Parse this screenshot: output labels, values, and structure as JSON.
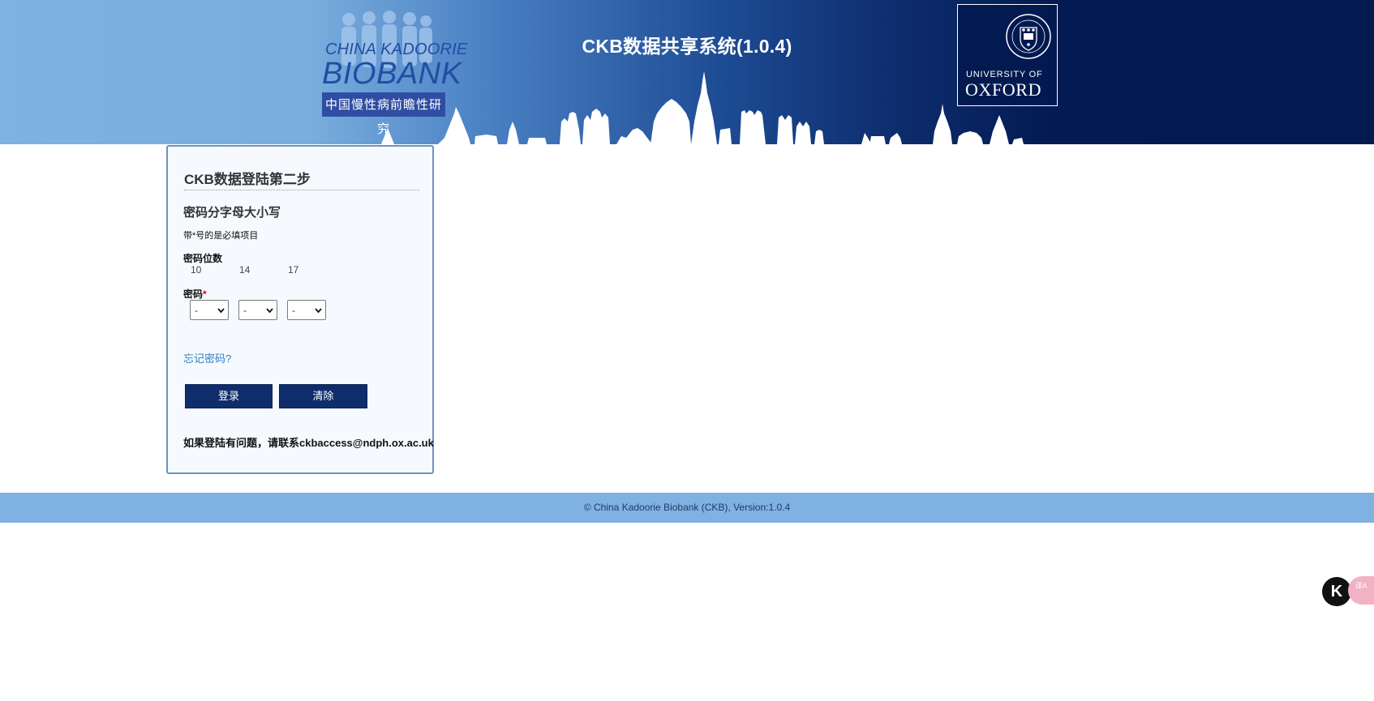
{
  "header": {
    "title": "CKB数据共享系统(1.0.4)",
    "ckb_logo": {
      "line1": "CHINA KADOORIE",
      "line2": "BIOBANK",
      "chinese": "中国慢性病前瞻性研究"
    },
    "oxford_logo": {
      "line1": "UNIVERSITY OF",
      "line2": "OXFORD"
    }
  },
  "login": {
    "title": "CKB数据登陆第二步",
    "case_note": "密码分字母大小写",
    "required_note": "带*号的是必填项目",
    "digits_label": "密码位数",
    "digits": [
      "10",
      "14",
      "17"
    ],
    "password_label": "密码",
    "required_marker": "*",
    "selects": [
      "-",
      "-",
      "-"
    ],
    "forgot": "忘记密码?",
    "login_button": "登录",
    "clear_button": "清除",
    "contact": "如果登陆有问题，请联系ckbaccess@ndph.ox.ac.uk"
  },
  "footer": {
    "text": "© China Kadoorie Biobank (CKB), Version:1.0.4"
  },
  "floating": {
    "k_label": "K",
    "translate_label": "译A"
  }
}
